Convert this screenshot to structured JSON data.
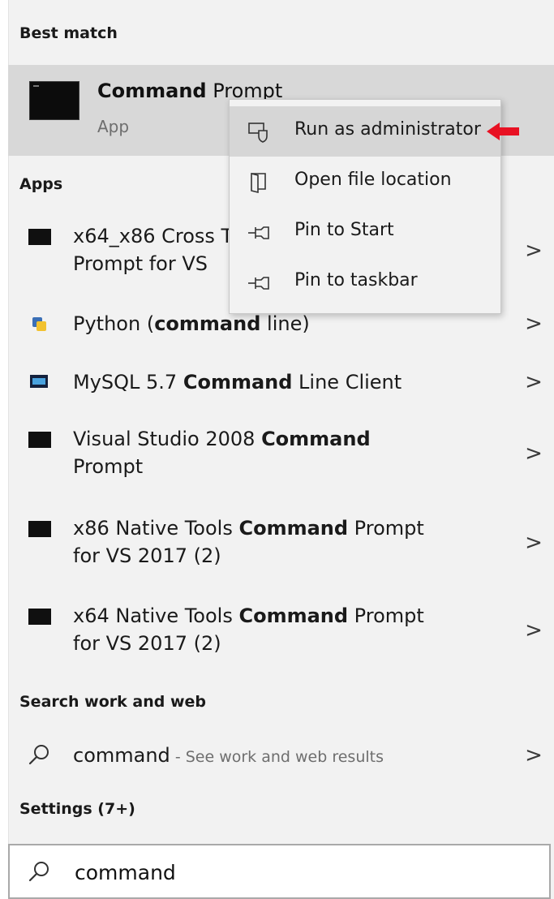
{
  "sections": {
    "best_match": "Best match",
    "apps": "Apps",
    "search_web": "Search work and web",
    "settings": "Settings (7+)"
  },
  "best_match": {
    "title_bold": "Command",
    "title_rest": " Prompt",
    "subtitle": "App"
  },
  "context_menu": {
    "items": [
      {
        "label": "Run as administrator",
        "icon": "shield-icon"
      },
      {
        "label": "Open file location",
        "icon": "folder-icon"
      },
      {
        "label": "Pin to Start",
        "icon": "pin-icon"
      },
      {
        "label": "Pin to taskbar",
        "icon": "pin-icon"
      }
    ]
  },
  "apps": [
    {
      "l1": "x64_x86 Cross T",
      "l2": "Prompt for VS",
      "icon": "console-icon"
    },
    {
      "pre": "Python (",
      "bold": "command",
      "post": " line)",
      "icon": "python-icon"
    },
    {
      "pre": "MySQL 5.7 ",
      "bold": "Command",
      "post": " Line Client",
      "icon": "mysql-icon"
    },
    {
      "pre": "Visual Studio 2008 ",
      "bold": "Command",
      "post": "",
      "l2": "Prompt",
      "icon": "console-icon"
    },
    {
      "pre": "x86 Native Tools ",
      "bold": "Command",
      "post": " Prompt",
      "l2": "for VS 2017 (2)",
      "icon": "console-icon"
    },
    {
      "pre": "x64 Native Tools ",
      "bold": "Command",
      "post": " Prompt",
      "l2": "for VS 2017 (2)",
      "icon": "console-icon"
    }
  ],
  "web_result": {
    "term": "command",
    "hint": " - See work and web results"
  },
  "chevron": ">",
  "search": {
    "value": "command"
  },
  "colors": {
    "highlight": "#d8d8d8",
    "arrow": "#e81123",
    "panel": "#f2f2f2"
  }
}
